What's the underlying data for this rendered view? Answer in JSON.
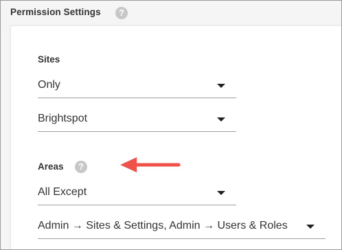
{
  "section": {
    "title": "Permission Settings",
    "help_icon": "question-mark-icon"
  },
  "sites": {
    "label": "Sites",
    "mode_value": "Only",
    "site_value": "Brightspot"
  },
  "areas": {
    "label": "Areas",
    "help_icon": "question-mark-icon",
    "mode_value": "All Except",
    "areas_value": "Admin → Sites & Settings, Admin → Users & Roles"
  },
  "icons": {
    "help_glyph": "?",
    "dropdown": "caret-down-icon",
    "annotation": "arrow-left-icon"
  },
  "colors": {
    "annotation_arrow": "#f0524a",
    "help_icon_bg": "#c7c7c7",
    "text": "#333333"
  }
}
